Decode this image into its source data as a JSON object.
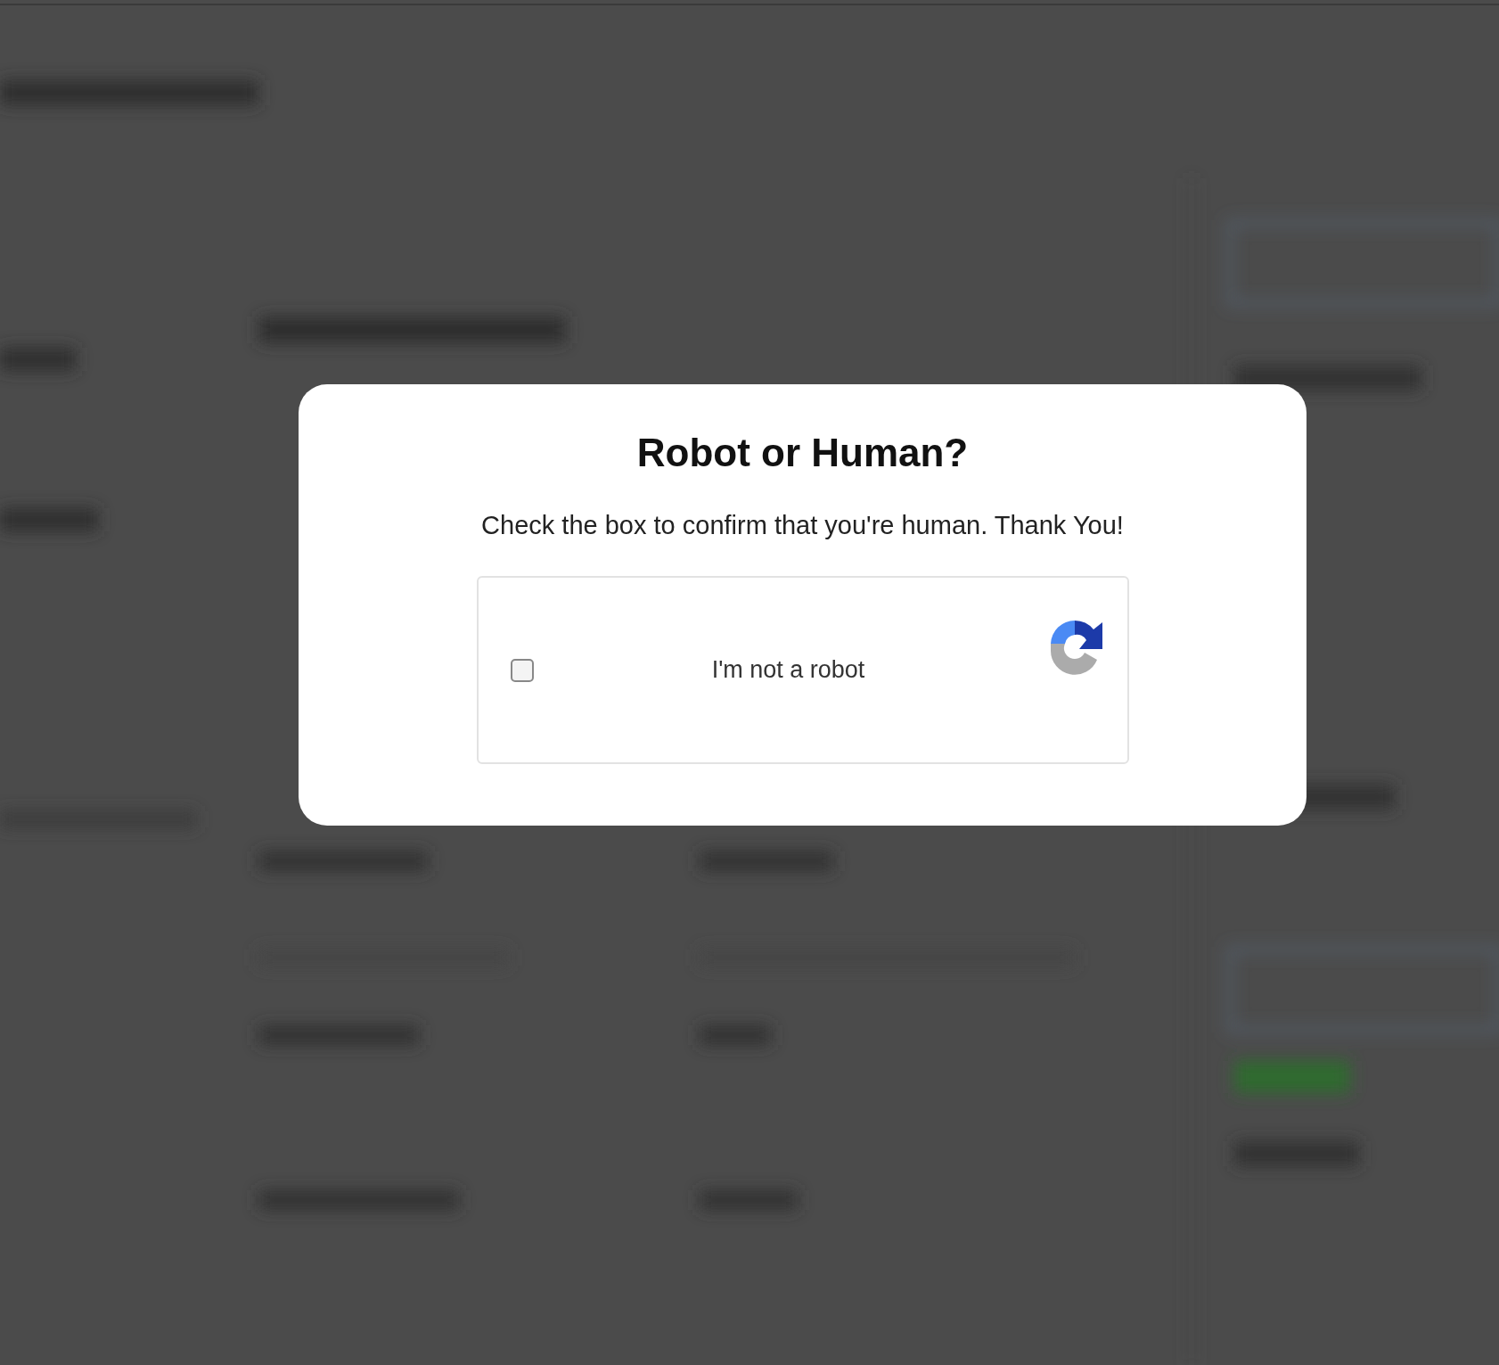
{
  "dialog": {
    "title": "Robot or Human?",
    "message": "Check the box to confirm that you're human. Thank You!",
    "captcha": {
      "label": "I'm not a robot",
      "checked": false
    }
  }
}
